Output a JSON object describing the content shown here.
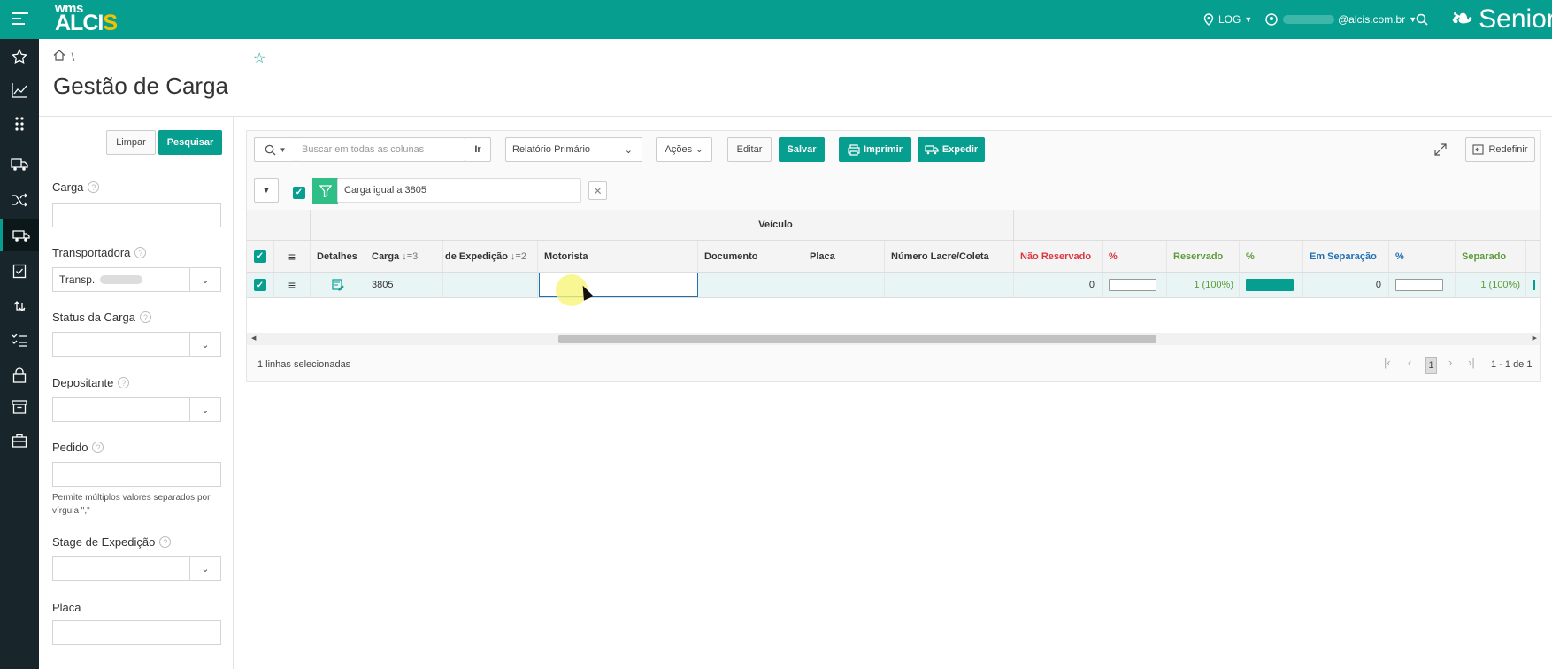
{
  "app": {
    "logo_top": "wms",
    "logo_main": "ALCI",
    "logo_accent": "S",
    "location": "LOG",
    "user_email": "@alcis.com.br",
    "brand": "Senior"
  },
  "colors": {
    "accent": "#069e8f",
    "sidebar": "#18262b",
    "red": "#d9363e",
    "green": "#5c9b3a",
    "blue": "#1f6fb5"
  },
  "sidebar": {
    "icons": [
      "star-icon",
      "chart-line-icon",
      "apps-icon",
      "truck-icon",
      "shuffle-icon",
      "truck-load-icon",
      "clipboard-check-icon",
      "sync-icon",
      "checklist-icon",
      "lock-icon",
      "archive-icon",
      "briefcase-icon"
    ]
  },
  "page": {
    "breadcrumb_sep": "\\",
    "title": "Gestão de Carga"
  },
  "filters": {
    "clear_label": "Limpar",
    "search_label": "Pesquisar",
    "carga_label": "Carga",
    "carga_value": "",
    "transportadora_label": "Transportadora",
    "transportadora_value": "Transp.",
    "status_label": "Status da Carga",
    "status_value": "",
    "depositante_label": "Depositante",
    "depositante_value": "",
    "pedido_label": "Pedido",
    "pedido_value": "",
    "pedido_hint": "Permite múltiplos valores separados por vírgula \",\"",
    "stage_label": "Stage de Expedição",
    "stage_value": "",
    "placa_label": "Placa",
    "placa_value": ""
  },
  "toolbar": {
    "search_placeholder": "Buscar em todas as colunas",
    "go_label": "Ir",
    "report_label": "Relatório Primário",
    "actions_label": "Ações",
    "edit_label": "Editar",
    "save_label": "Salvar",
    "print_label": "Imprimir",
    "dispatch_label": "Expedir",
    "reset_label": "Redefinir",
    "filter_text": "Carga igual a 3805"
  },
  "grid": {
    "group_header": "Veículo",
    "headers": {
      "detalhes": "Detalhes",
      "carga": "Carga",
      "carga_sort": "3",
      "stage": "de Expedição",
      "stage_sort": "2",
      "motorista": "Motorista",
      "documento": "Documento",
      "placa": "Placa",
      "lacre": "Número Lacre/Coleta",
      "nao_reservado": "Não Reservado",
      "pct1": "%",
      "reservado": "Reservado",
      "pct2": "%",
      "em_separacao": "Em Separação",
      "pct3": "%",
      "separado": "Separado"
    },
    "row": {
      "carga": "3805",
      "motorista": "",
      "documento": "",
      "placa": "",
      "lacre": "",
      "nao_reservado": "0",
      "pct1": 0,
      "reservado": "1 (100%)",
      "pct2": 1,
      "em_separacao": "0",
      "pct3": 0,
      "separado": "1 (100%)"
    },
    "selected_text": "1 linhas selecionadas",
    "page_current": "1",
    "range_text": "1 - 1 de 1"
  }
}
